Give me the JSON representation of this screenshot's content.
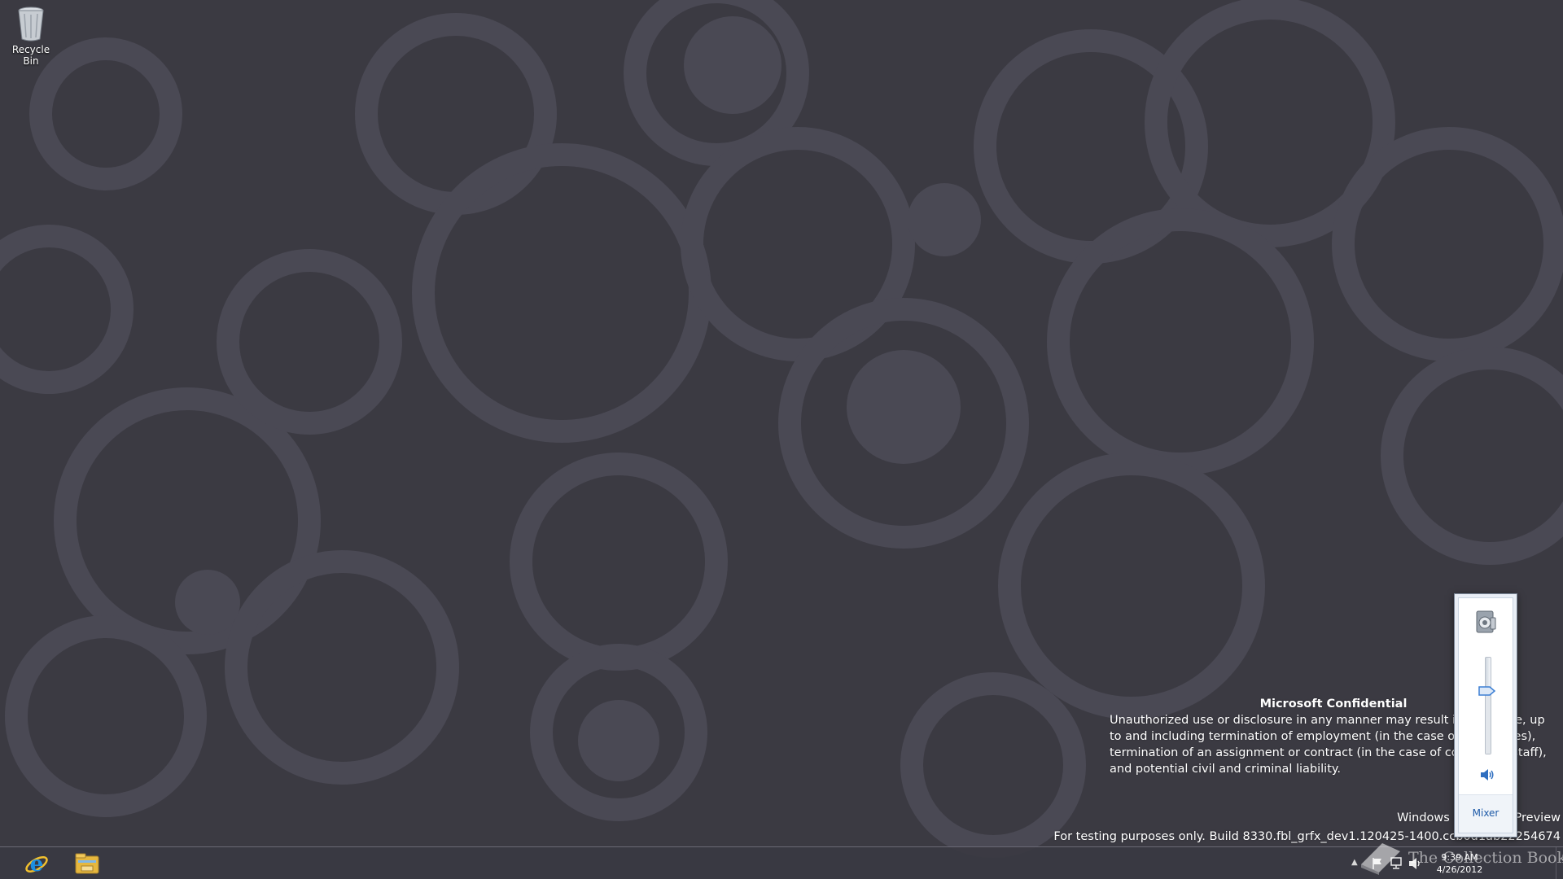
{
  "desktop": {
    "icons": [
      {
        "label": "Recycle Bin",
        "icon": "recycle-bin-icon"
      }
    ]
  },
  "watermark": {
    "title": "Microsoft Confidential",
    "body": "Unauthorized use or disclosure in any manner may result in discipline, up to and including termination of employment (in the case of employees), termination of an assignment or contract (in the case of contingent staff), and potential civil and criminal liability.",
    "edition": "Windows 8 Release Preview",
    "build": "For testing purposes only. Build 8330.fbl_grfx_dev1.120425-1400.ccb0d1ab22254674"
  },
  "volume_flyout": {
    "device_icon": "speakers-device-icon",
    "level_percent": 65,
    "mute_icon": "speaker-icon",
    "mixer_label": "Mixer"
  },
  "taskbar": {
    "pinned": [
      {
        "name": "Internet Explorer",
        "icon": "internet-explorer-icon"
      },
      {
        "name": "File Explorer",
        "icon": "file-explorer-icon"
      }
    ],
    "tray": {
      "time": "9:39 AM",
      "date": "4/26/2012"
    }
  },
  "overlay_text": "The Collection Book",
  "colors": {
    "desktop_background": "#3b3a42",
    "wallpaper_shape": "#4a4954",
    "mixer_link": "#1e5aa8"
  }
}
